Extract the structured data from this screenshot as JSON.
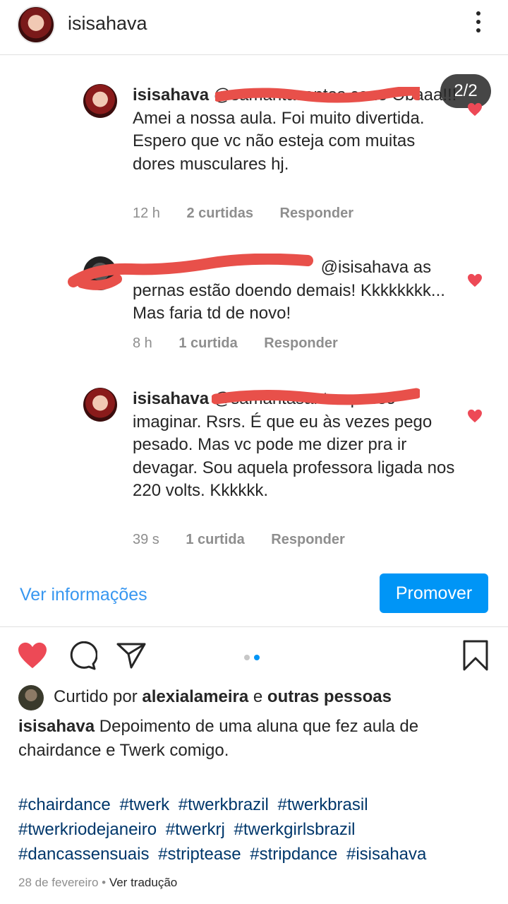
{
  "header": {
    "username": "isisahava"
  },
  "carousel": {
    "counter": "2/2"
  },
  "comments": [
    {
      "username": "isisahava",
      "mention": "@samantasantos.cane",
      "text": "Obaaa!!! Amei a nossa aula. Foi muito divertida. Espero que vc não esteja com muitas dores musculares hj.",
      "time": "12 h",
      "likes": "2 curtidas",
      "reply": "Responder"
    },
    {
      "username": "",
      "mention": "@isisahava",
      "text": "as pernas estão doendo demais! Kkkkkkkk... Mas faria td de novo!",
      "time": "8 h",
      "likes": "1 curtida",
      "reply": "Responder"
    },
    {
      "username": "isisahava",
      "mention": "@samantasantos",
      "text": "posso imaginar. Rsrs. É que eu às vezes pego pesado. Mas vc pode me dizer pra ir devagar. Sou aquela professora ligada nos 220 volts. Kkkkkk.",
      "time": "39 s",
      "likes": "1 curtida",
      "reply": "Responder"
    }
  ],
  "actions": {
    "info_link": "Ver informações",
    "promote": "Promover"
  },
  "likes": {
    "prefix": "Curtido por",
    "user": "alexialameira",
    "connector": "e",
    "others": "outras pessoas"
  },
  "caption": {
    "username": "isisahava",
    "text": "Depoimento de uma aluna que fez aula de chairdance e Twerk comigo."
  },
  "hashtags": [
    "#chairdance",
    "#twerk",
    "#twerkbrazil",
    "#twerkbrasil",
    "#twerkriodejaneiro",
    "#twerkrj",
    "#twerkgirlsbrazil",
    "#dancassensuais",
    "#striptease",
    "#stripdance",
    "#isisahava"
  ],
  "footer": {
    "date": "28 de fevereiro",
    "separator": "•",
    "translate": "Ver tradução"
  },
  "colors": {
    "link_blue": "#3897f0",
    "button_blue": "#0095f6",
    "heart_red": "#ed4956",
    "scribble_red": "#e8504a",
    "hashtag_blue": "#00376b"
  }
}
